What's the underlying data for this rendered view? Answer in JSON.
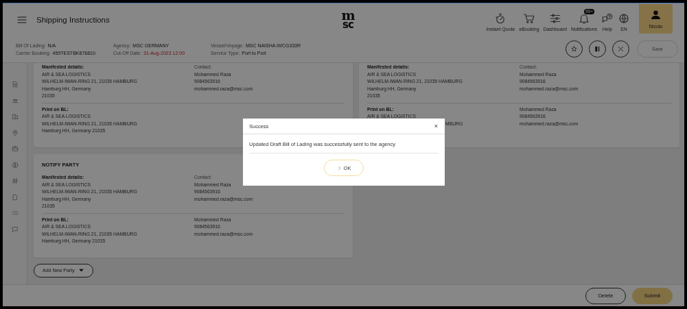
{
  "header": {
    "title": "Shipping Instructions",
    "logo": [
      "m",
      "sc"
    ],
    "nav": [
      {
        "label": "Instant Quote"
      },
      {
        "label": "eBooking"
      },
      {
        "label": "Dashboard"
      },
      {
        "label": "Notifications",
        "badge": "99+"
      },
      {
        "label": "Help"
      },
      {
        "label": "EN"
      }
    ],
    "user": {
      "name": "Nicolo"
    }
  },
  "info": [
    [
      {
        "label": "Bill Of Lading:",
        "value": "N/A",
        "alert": false
      },
      {
        "label": "Carrier Booking:",
        "value": "459TESTBK876810",
        "alert": false
      }
    ],
    [
      {
        "label": "Agency:",
        "value": "MSC GERMANY",
        "alert": false
      },
      {
        "label": "Cut-Off Date:",
        "value": "31-Aug-2023 12:00",
        "alert": true
      }
    ],
    [
      {
        "label": "Vessel/Voyage:",
        "value": "MSC NAISHA III/CG333R",
        "alert": false
      },
      {
        "label": "Service Type:",
        "value": "Port to Port",
        "alert": false
      }
    ]
  ],
  "actions": [
    {
      "kind": "icon"
    },
    {
      "kind": "icon"
    },
    {
      "kind": "icon"
    },
    {
      "kind": "text",
      "label": "Save",
      "disabled": true
    }
  ],
  "cards": [
    {
      "sections": [
        {
          "label": "Manifested details:",
          "lines": [
            {
              "text": "AIR & SEA LOGISTICS",
              "cut": false
            },
            {
              "text": "WILHELM-IWAN-RING 21, 21035 HAMBURG",
              "cut": false
            },
            {
              "text": "Hamburg HH, Germany",
              "cut": false
            },
            {
              "text": "21035",
              "cut": false
            }
          ],
          "contact": {
            "label": "Contact:",
            "lines": [
              "Mohammed Raza",
              "9084563916",
              "mohammed.raza@msc.com"
            ]
          }
        },
        {
          "label": "Print on BL:",
          "lines": [
            {
              "text": "AIR & SEA LOGISTICS",
              "cut": false
            },
            {
              "text": "WILHELM-IWAN-RING 21, 21035 HAMBURG",
              "cut": false
            },
            {
              "text": "Hamburg HH, Germany 21035",
              "cut": false
            }
          ]
        }
      ]
    },
    {
      "sections": [
        {
          "label": "Manifested details:",
          "lines": [
            {
              "text": "AIR & SEA LOGISTICS",
              "cut": false
            },
            {
              "text": "WILHELM-IWAN-RING 21, 21035 HAMBURG",
              "cut": false
            },
            {
              "text": "Hamburg HH, Germany",
              "cut": false
            },
            {
              "text": "21035",
              "cut": false
            }
          ],
          "contact": {
            "label": "Contact:",
            "lines": [
              "Mohammed Raza",
              "9084563916",
              "mohammed.raza@msc.com"
            ]
          }
        },
        {
          "label": "Print on BL:",
          "lines": [
            {
              "text": "AIR & SEA LOGISTICS",
              "cut": false
            },
            {
              "text": "MBURG",
              "cut": true
            }
          ],
          "contact": {
            "lines": [
              "Mohammed Raza",
              "9084563916",
              "mohammed.raza@msc.com"
            ]
          }
        }
      ]
    },
    {
      "title": "NOTIFY PARTY",
      "sections": [
        {
          "label": "Manifested details:",
          "lines": [
            {
              "text": "AIR & SEA LOGISTICS",
              "cut": false
            },
            {
              "text": "WILHELM-IWAN-RING 21, 21035 HAMBURG",
              "cut": false
            },
            {
              "text": "Hamburg HH, Germany",
              "cut": false
            },
            {
              "text": "21035",
              "cut": false
            }
          ],
          "contact": {
            "label": "Contact:",
            "lines": [
              "Mohammed Raza",
              "9084563916",
              "mohammed.raza@msc.com"
            ]
          }
        },
        {
          "label": "Print on BL:",
          "lines": [
            {
              "text": "AIR & SEA LOGISTICS",
              "cut": false
            },
            {
              "text": "WILHELM-IWAN-RING 21, 21035 HAMBURG",
              "cut": false
            },
            {
              "text": "Hamburg HH, Germany 21035",
              "cut": false
            }
          ],
          "contact": {
            "lines": [
              "Mohammed Raza",
              "9084563916",
              "mohammed.raza@msc.com"
            ]
          }
        }
      ]
    }
  ],
  "add_party": {
    "label": "Add New Party"
  },
  "footer": {
    "buttons": [
      {
        "label": "Delete",
        "kind": "outline"
      },
      {
        "label": "Submit",
        "kind": "primary"
      }
    ]
  },
  "dialog": {
    "title": "Success",
    "close": "×",
    "message": "Updated Draft Bill of Lading was successfully sent to the agency",
    "button": "OK"
  }
}
